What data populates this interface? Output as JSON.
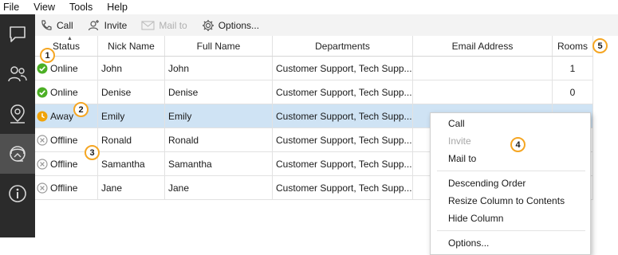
{
  "menubar": {
    "items": [
      "File",
      "View",
      "Tools",
      "Help"
    ]
  },
  "sidebar": {
    "items": [
      {
        "icon": "chat-icon"
      },
      {
        "icon": "users-icon"
      },
      {
        "icon": "location-pin-icon"
      },
      {
        "icon": "headset-support-icon",
        "active": true
      },
      {
        "icon": "info-icon"
      }
    ]
  },
  "toolbar": {
    "call_label": "Call",
    "invite_label": "Invite",
    "mail_label": "Mail to",
    "options_label": "Options..."
  },
  "table": {
    "columns": [
      "Status",
      "Nick Name",
      "Full Name",
      "Departments",
      "Email Address",
      "Rooms"
    ],
    "rows": [
      {
        "status": "Online",
        "nick": "John",
        "full": "John",
        "dept": "Customer Support, Tech Supp...",
        "email": "",
        "rooms": "1"
      },
      {
        "status": "Online",
        "nick": "Denise",
        "full": "Denise",
        "dept": "Customer Support, Tech Supp...",
        "email": "",
        "rooms": "0"
      },
      {
        "status": "Away",
        "nick": "Emily",
        "full": "Emily",
        "dept": "Customer Support, Tech Supp...",
        "email": "",
        "rooms": ""
      },
      {
        "status": "Offline",
        "nick": "Ronald",
        "full": "Ronald",
        "dept": "Customer Support, Tech Supp...",
        "email": "",
        "rooms": ""
      },
      {
        "status": "Offline",
        "nick": "Samantha",
        "full": "Samantha",
        "dept": "Customer Support, Tech Supp...",
        "email": "",
        "rooms": ""
      },
      {
        "status": "Offline",
        "nick": "Jane",
        "full": "Jane",
        "dept": "Customer Support, Tech Supp...",
        "email": "",
        "rooms": ""
      }
    ]
  },
  "context_menu": {
    "call": "Call",
    "invite": "Invite",
    "mail_to": "Mail to",
    "descending_order": "Descending Order",
    "resize_column": "Resize Column to Contents",
    "hide_column": "Hide Column",
    "options": "Options..."
  },
  "callouts": [
    "1",
    "2",
    "3",
    "4",
    "5"
  ],
  "colors": {
    "online": "#4caf25",
    "away": "#f0a30a",
    "offline": "#9a9a9a",
    "selected_row": "#cfe3f4",
    "callout_border": "#f5a623",
    "sidebar_bg": "#2b2b2b"
  }
}
